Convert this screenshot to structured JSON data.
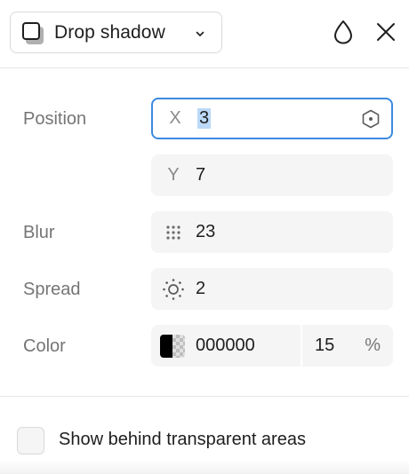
{
  "header": {
    "type_label": "Drop shadow",
    "icons": {
      "type": "drop-shadow-icon",
      "chevron": "chevron-down-icon",
      "style": "drop-icon",
      "close": "close-icon"
    }
  },
  "position": {
    "label": "Position",
    "x_prefix": "X",
    "x_value": "3",
    "y_prefix": "Y",
    "y_value": "7"
  },
  "blur": {
    "label": "Blur",
    "value": "23",
    "icon": "blur-dots-icon"
  },
  "spread": {
    "label": "Spread",
    "value": "2",
    "icon": "spread-sun-icon"
  },
  "color": {
    "label": "Color",
    "hex": "000000",
    "opacity": "15",
    "percent_sign": "%"
  },
  "option": {
    "label": "Show behind transparent areas",
    "checked": false
  },
  "colors": {
    "accent": "#3d8ae0",
    "selection": "#bcd9f7",
    "field_bg": "#f5f5f5",
    "label": "#757575"
  }
}
